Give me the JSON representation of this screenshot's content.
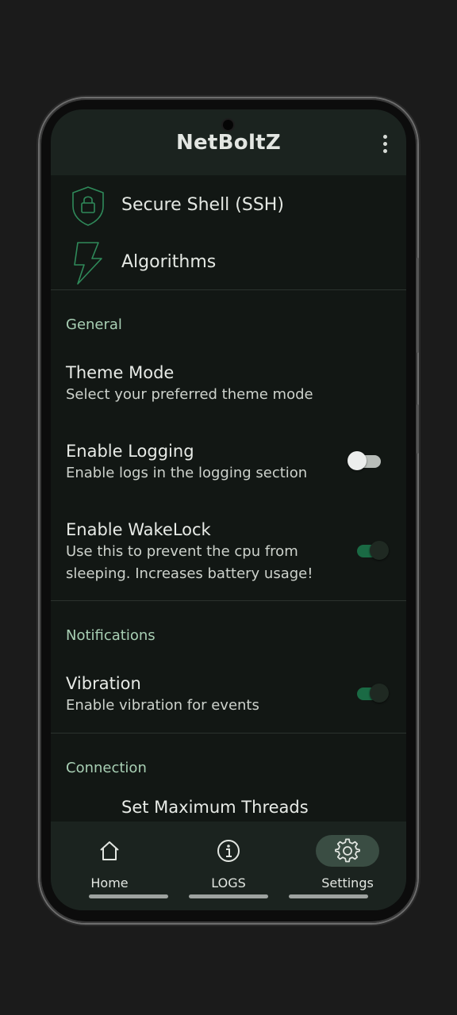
{
  "app": {
    "title": "NetBoltZ",
    "more_icon": "more-vertical-icon"
  },
  "menu": [
    {
      "label": "Secure Shell (SSH)",
      "icon": "shield-lock-icon"
    },
    {
      "label": "Algorithms",
      "icon": "lightning-bolt-icon"
    }
  ],
  "sections": {
    "general": {
      "title": "General",
      "theme_mode": {
        "title": "Theme Mode",
        "desc": "Select your preferred theme mode"
      },
      "logging": {
        "title": "Enable Logging",
        "desc": "Enable logs in the logging section",
        "enabled": false
      },
      "wakelock": {
        "title": "Enable WakeLock",
        "desc_line1": "Use this to prevent the cpu from",
        "desc_line2": "sleeping. Increases battery usage!",
        "enabled": true
      }
    },
    "notifications": {
      "title": "Notifications",
      "vibration": {
        "title": "Vibration",
        "desc": "Enable vibration for events",
        "enabled": true
      }
    },
    "connection": {
      "title": "Connection",
      "max_threads": {
        "title": "Set Maximum Threads"
      }
    }
  },
  "bottom_nav": {
    "items": [
      {
        "label": "Home",
        "icon": "home-icon",
        "active": false
      },
      {
        "label": "LOGS",
        "icon": "info-icon",
        "active": false
      },
      {
        "label": "Settings",
        "icon": "gear-icon",
        "active": true
      }
    ]
  },
  "colors": {
    "background": "#121714",
    "app_bar": "#1b231f",
    "accent_section": "#a8cfb4",
    "toggle_on": "#1a6a44",
    "icon_green": "#2f8a5a",
    "active_pill": "#3a4d43"
  }
}
